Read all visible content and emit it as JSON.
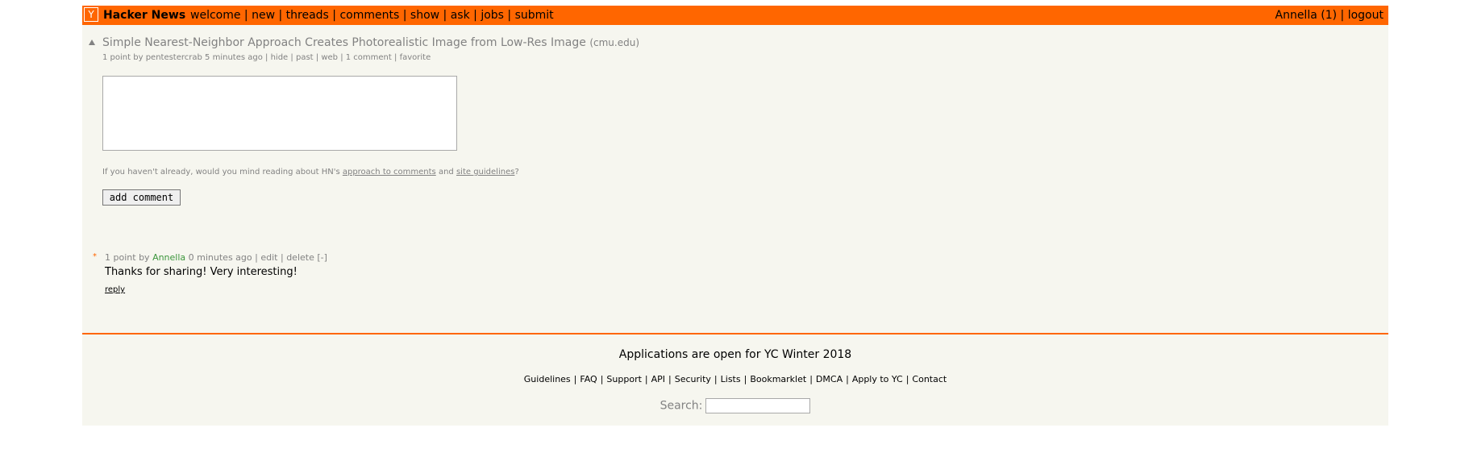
{
  "header": {
    "logo": "Y",
    "brand": "Hacker News",
    "nav": [
      "welcome",
      "new",
      "threads",
      "comments",
      "show",
      "ask",
      "jobs",
      "submit"
    ],
    "user": "Annella",
    "karma": "(1)",
    "logout": "logout",
    "separator": "|"
  },
  "story": {
    "title": "Simple Nearest-Neighbor Approach Creates Photorealistic Image from Low-Res Image",
    "site": "(cmu.edu)",
    "points": "1 point",
    "by": "by",
    "author": "pentestercrab",
    "age": "5 minutes ago",
    "links": [
      "hide",
      "past",
      "web",
      "1 comment",
      "favorite"
    ]
  },
  "reply_form": {
    "textarea_value": "",
    "hint_before": "If you haven't already, would you mind reading about HN's",
    "hint_link1": "approach to comments",
    "hint_and": "and",
    "hint_link2": "site guidelines",
    "hint_after": "?",
    "button": "add comment"
  },
  "comment": {
    "marker": "*",
    "points": "1 point",
    "by": "by",
    "user": "Annella",
    "age": "0 minutes ago",
    "edit": "edit",
    "delete": "delete",
    "toggle": "[-]",
    "text": "Thanks for sharing! Very interesting!",
    "reply": "reply"
  },
  "footer": {
    "yc": "Applications are open for YC Winter 2018",
    "links": [
      "Guidelines",
      "FAQ",
      "Support",
      "API",
      "Security",
      "Lists",
      "Bookmarklet",
      "DMCA",
      "Apply to YC",
      "Contact"
    ],
    "search_label": "Search:",
    "search_value": ""
  },
  "colors": {
    "accent": "#ff6600",
    "background": "#f6f6ef",
    "muted": "#828282",
    "user": "#3c963c"
  }
}
